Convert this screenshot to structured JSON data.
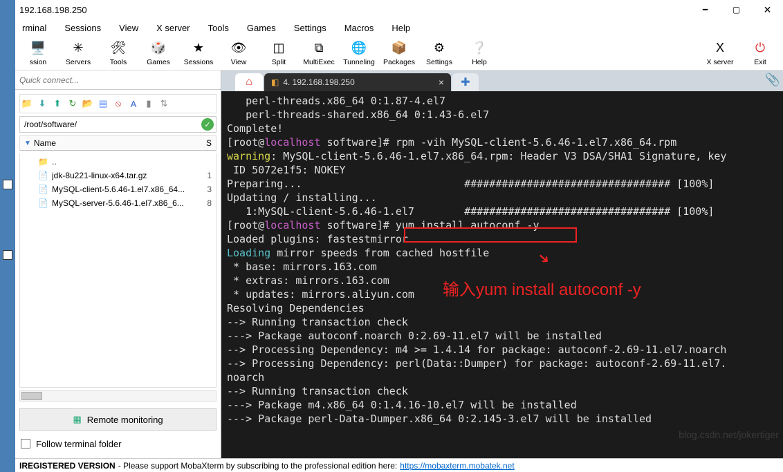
{
  "window": {
    "title": "192.168.198.250"
  },
  "menubar": [
    "rminal",
    "Sessions",
    "View",
    "X server",
    "Tools",
    "Games",
    "Settings",
    "Macros",
    "Help"
  ],
  "toolbar": [
    {
      "id": "ssion",
      "label": "ssion",
      "icon": "🖥️"
    },
    {
      "id": "servers",
      "label": "Servers",
      "icon": "✳"
    },
    {
      "id": "tools",
      "label": "Tools",
      "icon": "🛠"
    },
    {
      "id": "games",
      "label": "Games",
      "icon": "🎲"
    },
    {
      "id": "sessions",
      "label": "Sessions",
      "icon": "★"
    },
    {
      "id": "view",
      "label": "View",
      "icon": "👁"
    },
    {
      "id": "split",
      "label": "Split",
      "icon": "◫"
    },
    {
      "id": "multiexec",
      "label": "MultiExec",
      "icon": "⧉"
    },
    {
      "id": "tunneling",
      "label": "Tunneling",
      "icon": "🌐"
    },
    {
      "id": "packages",
      "label": "Packages",
      "icon": "📦"
    },
    {
      "id": "settings",
      "label": "Settings",
      "icon": "⚙"
    },
    {
      "id": "help",
      "label": "Help",
      "icon": "❔"
    }
  ],
  "toolbar_right": [
    {
      "id": "xserver",
      "label": "X server",
      "icon": "X",
      "color": "#000"
    },
    {
      "id": "exit",
      "label": "Exit",
      "icon": "⏻",
      "color": "#d33"
    }
  ],
  "quick_connect": {
    "placeholder": "Quick connect..."
  },
  "sftp": {
    "path": "/root/software/",
    "columns": {
      "name": "Name",
      "size": "S"
    },
    "files": [
      {
        "icon": "📁",
        "name": "..",
        "size": ""
      },
      {
        "icon": "📄",
        "name": "jdk-8u221-linux-x64.tar.gz",
        "size": "1"
      },
      {
        "icon": "📄",
        "name": "MySQL-client-5.6.46-1.el7.x86_64...",
        "size": "3"
      },
      {
        "icon": "📄",
        "name": "MySQL-server-5.6.46-1.el7.x86_6...",
        "size": "8"
      }
    ]
  },
  "remote_monitoring": "Remote monitoring",
  "follow_terminal": "Follow terminal folder",
  "tabs": [
    {
      "kind": "home",
      "label": "",
      "icon": "⌂"
    },
    {
      "kind": "session",
      "label": "4. 192.168.198.250",
      "icon": "◧"
    },
    {
      "kind": "add",
      "label": "+",
      "icon": "+"
    }
  ],
  "terminal_lines": [
    {
      "t": "   perl-threads.x86_64 0:1.87-4.el7"
    },
    {
      "t": "   perl-threads-shared.x86_64 0:1.43-6.el7"
    },
    {
      "t": ""
    },
    {
      "t": "Complete!"
    },
    {
      "seg": [
        {
          "c": "",
          "t": "["
        },
        {
          "c": "",
          "t": "root@"
        },
        {
          "c": "mag",
          "t": "localhost"
        },
        {
          "c": "",
          "t": " software]# rpm -vih MySQL-client-5.6.46-1.el7.x86_64.rpm"
        }
      ]
    },
    {
      "seg": [
        {
          "c": "yel",
          "t": "warning"
        },
        {
          "c": "",
          "t": ": MySQL-client-5.6.46-1.el7.x86_64.rpm: Header V3 DSA/SHA1 Signature, key"
        }
      ]
    },
    {
      "t": " ID 5072e1f5: NOKEY"
    },
    {
      "t": "Preparing...                          ################################# [100%]"
    },
    {
      "t": "Updating / installing..."
    },
    {
      "t": "   1:MySQL-client-5.6.46-1.el7        ################################# [100%]"
    },
    {
      "seg": [
        {
          "c": "",
          "t": "["
        },
        {
          "c": "",
          "t": "root@"
        },
        {
          "c": "mag",
          "t": "localhost"
        },
        {
          "c": "",
          "t": " software]# yum install autoconf -y"
        }
      ]
    },
    {
      "t": "Loaded plugins: fastestmirror"
    },
    {
      "seg": [
        {
          "c": "cyn",
          "t": "Loading"
        },
        {
          "c": "",
          "t": " mirror speeds from cached hostfile"
        }
      ]
    },
    {
      "t": " * base: mirrors.163.com"
    },
    {
      "t": " * extras: mirrors.163.com"
    },
    {
      "t": " * updates: mirrors.aliyun.com"
    },
    {
      "t": "Resolving Dependencies"
    },
    {
      "t": "--> Running transaction check"
    },
    {
      "t": "---> Package autoconf.noarch 0:2.69-11.el7 will be installed"
    },
    {
      "t": "--> Processing Dependency: m4 >= 1.4.14 for package: autoconf-2.69-11.el7.noarch"
    },
    {
      "t": "--> Processing Dependency: perl(Data::Dumper) for package: autoconf-2.69-11.el7."
    },
    {
      "t": "noarch"
    },
    {
      "t": "--> Running transaction check"
    },
    {
      "t": "---> Package m4.x86_64 0:1.4.16-10.el7 will be installed"
    },
    {
      "t": "---> Package perl-Data-Dumper.x86_64 0:2.145-3.el7 will be installed"
    }
  ],
  "annotation": {
    "text": "输入yum install autoconf -y"
  },
  "watermark": "blog.csdn.net/jokertiger",
  "footer": {
    "b": "IREGISTERED VERSION",
    "mid": " -  Please support MobaXterm by subscribing to the professional edition here:  ",
    "link": "https://mobaxterm.mobatek.net"
  }
}
